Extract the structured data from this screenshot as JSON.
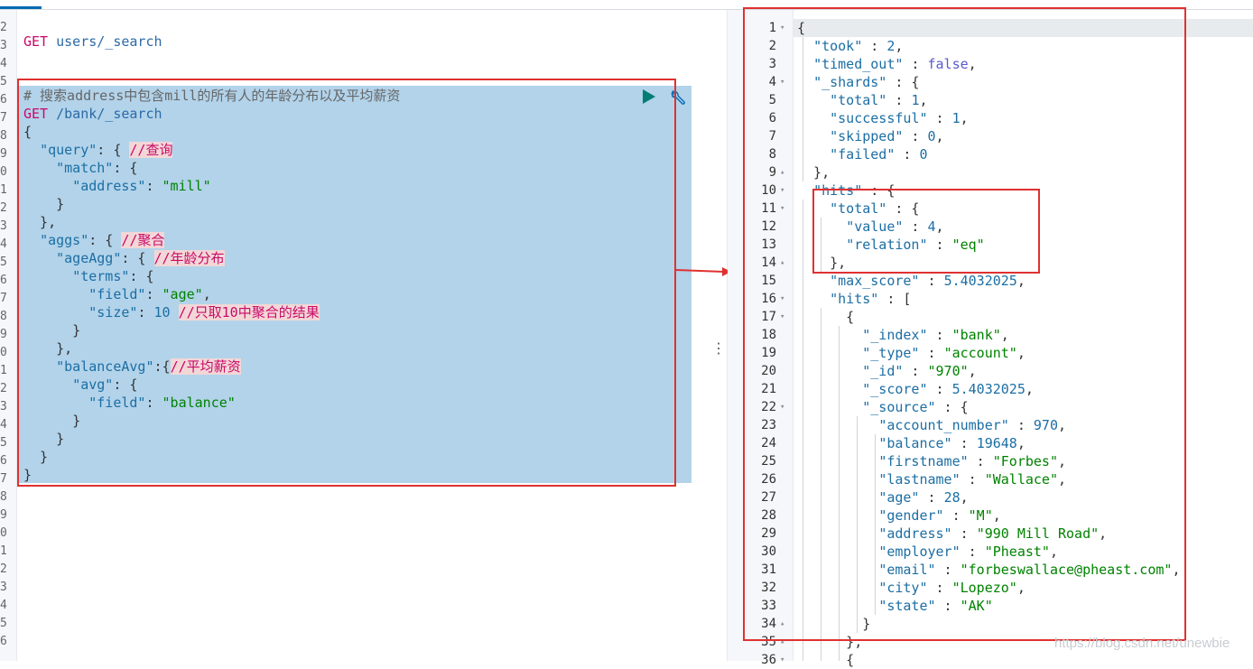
{
  "left_editor": {
    "lines": [
      {
        "segments": [
          {
            "t": "GET",
            "c": "method"
          },
          {
            "t": " users/_search",
            "c": "url"
          }
        ]
      },
      {
        "segments": []
      },
      {
        "segments": []
      },
      {
        "segments": [
          {
            "t": "# 搜索address中包含mill的所有人的年龄分布以及平均薪资",
            "c": "comment"
          }
        ]
      },
      {
        "segments": [
          {
            "t": "GET",
            "c": "method"
          },
          {
            "t": " /bank/_search",
            "c": "url"
          }
        ]
      },
      {
        "segments": [
          {
            "t": "{",
            "c": "punc"
          }
        ]
      },
      {
        "segments": [
          {
            "t": "  ",
            "c": "punc"
          },
          {
            "t": "\"query\"",
            "c": "key"
          },
          {
            "t": ": { ",
            "c": "punc"
          },
          {
            "t": "//查询",
            "c": "comment-hl"
          }
        ]
      },
      {
        "segments": [
          {
            "t": "    ",
            "c": "punc"
          },
          {
            "t": "\"match\"",
            "c": "key"
          },
          {
            "t": ": {",
            "c": "punc"
          }
        ]
      },
      {
        "segments": [
          {
            "t": "      ",
            "c": "punc"
          },
          {
            "t": "\"address\"",
            "c": "key"
          },
          {
            "t": ": ",
            "c": "punc"
          },
          {
            "t": "\"mill\"",
            "c": "str"
          }
        ]
      },
      {
        "segments": [
          {
            "t": "    }",
            "c": "punc"
          }
        ]
      },
      {
        "segments": [
          {
            "t": "  },",
            "c": "punc"
          }
        ]
      },
      {
        "segments": [
          {
            "t": "  ",
            "c": "punc"
          },
          {
            "t": "\"aggs\"",
            "c": "key"
          },
          {
            "t": ": { ",
            "c": "punc"
          },
          {
            "t": "//聚合",
            "c": "comment-hl"
          }
        ]
      },
      {
        "segments": [
          {
            "t": "    ",
            "c": "punc"
          },
          {
            "t": "\"ageAgg\"",
            "c": "key"
          },
          {
            "t": ": { ",
            "c": "punc"
          },
          {
            "t": "//年龄分布",
            "c": "comment-hl"
          }
        ]
      },
      {
        "segments": [
          {
            "t": "      ",
            "c": "punc"
          },
          {
            "t": "\"terms\"",
            "c": "key"
          },
          {
            "t": ": {",
            "c": "punc"
          }
        ]
      },
      {
        "segments": [
          {
            "t": "        ",
            "c": "punc"
          },
          {
            "t": "\"field\"",
            "c": "key"
          },
          {
            "t": ": ",
            "c": "punc"
          },
          {
            "t": "\"age\"",
            "c": "str"
          },
          {
            "t": ",",
            "c": "punc"
          }
        ]
      },
      {
        "segments": [
          {
            "t": "        ",
            "c": "punc"
          },
          {
            "t": "\"size\"",
            "c": "key"
          },
          {
            "t": ": ",
            "c": "punc"
          },
          {
            "t": "10",
            "c": "num"
          },
          {
            "t": " ",
            "c": "punc"
          },
          {
            "t": "//只取10中聚合的结果",
            "c": "comment-hl"
          }
        ]
      },
      {
        "segments": [
          {
            "t": "      }",
            "c": "punc"
          }
        ]
      },
      {
        "segments": [
          {
            "t": "    },",
            "c": "punc"
          }
        ]
      },
      {
        "segments": [
          {
            "t": "    ",
            "c": "punc"
          },
          {
            "t": "\"balanceAvg\"",
            "c": "key"
          },
          {
            "t": ":{",
            "c": "punc"
          },
          {
            "t": "//平均薪资",
            "c": "comment-hl"
          }
        ]
      },
      {
        "segments": [
          {
            "t": "      ",
            "c": "punc"
          },
          {
            "t": "\"avg\"",
            "c": "key"
          },
          {
            "t": ": {",
            "c": "punc"
          }
        ]
      },
      {
        "segments": [
          {
            "t": "        ",
            "c": "punc"
          },
          {
            "t": "\"field\"",
            "c": "key"
          },
          {
            "t": ": ",
            "c": "punc"
          },
          {
            "t": "\"balance\"",
            "c": "str"
          }
        ]
      },
      {
        "segments": [
          {
            "t": "      }",
            "c": "punc"
          }
        ]
      },
      {
        "segments": [
          {
            "t": "    }",
            "c": "punc"
          }
        ]
      },
      {
        "segments": [
          {
            "t": "  }",
            "c": "punc"
          }
        ]
      },
      {
        "segments": [
          {
            "t": "}",
            "c": "punc"
          }
        ]
      }
    ],
    "gutter_numbers": [
      "",
      "2",
      "3",
      "4",
      "5",
      "6",
      "7",
      "8",
      "9",
      "0",
      "1",
      "2",
      "3",
      "4",
      "5",
      "6",
      "7",
      "8",
      "9",
      "0",
      "1",
      "2",
      "3",
      "4",
      "5",
      "6",
      "7",
      "8",
      "9",
      "0",
      "1",
      "2",
      "3",
      "4",
      "5",
      "6"
    ]
  },
  "right_output": {
    "lines": [
      {
        "n": "1",
        "f": "▾",
        "segments": [
          {
            "t": "{",
            "c": "punc"
          }
        ]
      },
      {
        "n": "2",
        "f": "",
        "segments": [
          {
            "t": "  ",
            "c": "punc"
          },
          {
            "t": "\"took\"",
            "c": "key"
          },
          {
            "t": " : ",
            "c": "punc"
          },
          {
            "t": "2",
            "c": "num"
          },
          {
            "t": ",",
            "c": "punc"
          }
        ]
      },
      {
        "n": "3",
        "f": "",
        "segments": [
          {
            "t": "  ",
            "c": "punc"
          },
          {
            "t": "\"timed_out\"",
            "c": "key"
          },
          {
            "t": " : ",
            "c": "punc"
          },
          {
            "t": "false",
            "c": "bool"
          },
          {
            "t": ",",
            "c": "punc"
          }
        ]
      },
      {
        "n": "4",
        "f": "▾",
        "segments": [
          {
            "t": "  ",
            "c": "punc"
          },
          {
            "t": "\"_shards\"",
            "c": "key"
          },
          {
            "t": " : {",
            "c": "punc"
          }
        ]
      },
      {
        "n": "5",
        "f": "",
        "segments": [
          {
            "t": "    ",
            "c": "punc"
          },
          {
            "t": "\"total\"",
            "c": "key"
          },
          {
            "t": " : ",
            "c": "punc"
          },
          {
            "t": "1",
            "c": "num"
          },
          {
            "t": ",",
            "c": "punc"
          }
        ]
      },
      {
        "n": "6",
        "f": "",
        "segments": [
          {
            "t": "    ",
            "c": "punc"
          },
          {
            "t": "\"successful\"",
            "c": "key"
          },
          {
            "t": " : ",
            "c": "punc"
          },
          {
            "t": "1",
            "c": "num"
          },
          {
            "t": ",",
            "c": "punc"
          }
        ]
      },
      {
        "n": "7",
        "f": "",
        "segments": [
          {
            "t": "    ",
            "c": "punc"
          },
          {
            "t": "\"skipped\"",
            "c": "key"
          },
          {
            "t": " : ",
            "c": "punc"
          },
          {
            "t": "0",
            "c": "num"
          },
          {
            "t": ",",
            "c": "punc"
          }
        ]
      },
      {
        "n": "8",
        "f": "",
        "segments": [
          {
            "t": "    ",
            "c": "punc"
          },
          {
            "t": "\"failed\"",
            "c": "key"
          },
          {
            "t": " : ",
            "c": "punc"
          },
          {
            "t": "0",
            "c": "num"
          }
        ]
      },
      {
        "n": "9",
        "f": "▴",
        "segments": [
          {
            "t": "  },",
            "c": "punc"
          }
        ]
      },
      {
        "n": "10",
        "f": "▾",
        "segments": [
          {
            "t": "  ",
            "c": "punc"
          },
          {
            "t": "\"hits\"",
            "c": "key"
          },
          {
            "t": " : {",
            "c": "punc"
          }
        ]
      },
      {
        "n": "11",
        "f": "▾",
        "segments": [
          {
            "t": "    ",
            "c": "punc"
          },
          {
            "t": "\"total\"",
            "c": "key"
          },
          {
            "t": " : {",
            "c": "punc"
          }
        ]
      },
      {
        "n": "12",
        "f": "",
        "segments": [
          {
            "t": "      ",
            "c": "punc"
          },
          {
            "t": "\"value\"",
            "c": "key"
          },
          {
            "t": " : ",
            "c": "punc"
          },
          {
            "t": "4",
            "c": "num"
          },
          {
            "t": ",",
            "c": "punc"
          }
        ]
      },
      {
        "n": "13",
        "f": "",
        "segments": [
          {
            "t": "      ",
            "c": "punc"
          },
          {
            "t": "\"relation\"",
            "c": "key"
          },
          {
            "t": " : ",
            "c": "punc"
          },
          {
            "t": "\"eq\"",
            "c": "str"
          }
        ]
      },
      {
        "n": "14",
        "f": "▴",
        "segments": [
          {
            "t": "    },",
            "c": "punc"
          }
        ]
      },
      {
        "n": "15",
        "f": "",
        "segments": [
          {
            "t": "    ",
            "c": "punc"
          },
          {
            "t": "\"max_score\"",
            "c": "key"
          },
          {
            "t": " : ",
            "c": "punc"
          },
          {
            "t": "5.4032025",
            "c": "num"
          },
          {
            "t": ",",
            "c": "punc"
          }
        ]
      },
      {
        "n": "16",
        "f": "▾",
        "segments": [
          {
            "t": "    ",
            "c": "punc"
          },
          {
            "t": "\"hits\"",
            "c": "key"
          },
          {
            "t": " : [",
            "c": "punc"
          }
        ]
      },
      {
        "n": "17",
        "f": "▾",
        "segments": [
          {
            "t": "      {",
            "c": "punc"
          }
        ]
      },
      {
        "n": "18",
        "f": "",
        "segments": [
          {
            "t": "        ",
            "c": "punc"
          },
          {
            "t": "\"_index\"",
            "c": "key"
          },
          {
            "t": " : ",
            "c": "punc"
          },
          {
            "t": "\"bank\"",
            "c": "str"
          },
          {
            "t": ",",
            "c": "punc"
          }
        ]
      },
      {
        "n": "19",
        "f": "",
        "segments": [
          {
            "t": "        ",
            "c": "punc"
          },
          {
            "t": "\"_type\"",
            "c": "key"
          },
          {
            "t": " : ",
            "c": "punc"
          },
          {
            "t": "\"account\"",
            "c": "str"
          },
          {
            "t": ",",
            "c": "punc"
          }
        ]
      },
      {
        "n": "20",
        "f": "",
        "segments": [
          {
            "t": "        ",
            "c": "punc"
          },
          {
            "t": "\"_id\"",
            "c": "key"
          },
          {
            "t": " : ",
            "c": "punc"
          },
          {
            "t": "\"970\"",
            "c": "str"
          },
          {
            "t": ",",
            "c": "punc"
          }
        ]
      },
      {
        "n": "21",
        "f": "",
        "segments": [
          {
            "t": "        ",
            "c": "punc"
          },
          {
            "t": "\"_score\"",
            "c": "key"
          },
          {
            "t": " : ",
            "c": "punc"
          },
          {
            "t": "5.4032025",
            "c": "num"
          },
          {
            "t": ",",
            "c": "punc"
          }
        ]
      },
      {
        "n": "22",
        "f": "▾",
        "segments": [
          {
            "t": "        ",
            "c": "punc"
          },
          {
            "t": "\"_source\"",
            "c": "key"
          },
          {
            "t": " : {",
            "c": "punc"
          }
        ]
      },
      {
        "n": "23",
        "f": "",
        "segments": [
          {
            "t": "          ",
            "c": "punc"
          },
          {
            "t": "\"account_number\"",
            "c": "key"
          },
          {
            "t": " : ",
            "c": "punc"
          },
          {
            "t": "970",
            "c": "num"
          },
          {
            "t": ",",
            "c": "punc"
          }
        ]
      },
      {
        "n": "24",
        "f": "",
        "segments": [
          {
            "t": "          ",
            "c": "punc"
          },
          {
            "t": "\"balance\"",
            "c": "key"
          },
          {
            "t": " : ",
            "c": "punc"
          },
          {
            "t": "19648",
            "c": "num"
          },
          {
            "t": ",",
            "c": "punc"
          }
        ]
      },
      {
        "n": "25",
        "f": "",
        "segments": [
          {
            "t": "          ",
            "c": "punc"
          },
          {
            "t": "\"firstname\"",
            "c": "key"
          },
          {
            "t": " : ",
            "c": "punc"
          },
          {
            "t": "\"Forbes\"",
            "c": "str"
          },
          {
            "t": ",",
            "c": "punc"
          }
        ]
      },
      {
        "n": "26",
        "f": "",
        "segments": [
          {
            "t": "          ",
            "c": "punc"
          },
          {
            "t": "\"lastname\"",
            "c": "key"
          },
          {
            "t": " : ",
            "c": "punc"
          },
          {
            "t": "\"Wallace\"",
            "c": "str"
          },
          {
            "t": ",",
            "c": "punc"
          }
        ]
      },
      {
        "n": "27",
        "f": "",
        "segments": [
          {
            "t": "          ",
            "c": "punc"
          },
          {
            "t": "\"age\"",
            "c": "key"
          },
          {
            "t": " : ",
            "c": "punc"
          },
          {
            "t": "28",
            "c": "num"
          },
          {
            "t": ",",
            "c": "punc"
          }
        ]
      },
      {
        "n": "28",
        "f": "",
        "segments": [
          {
            "t": "          ",
            "c": "punc"
          },
          {
            "t": "\"gender\"",
            "c": "key"
          },
          {
            "t": " : ",
            "c": "punc"
          },
          {
            "t": "\"M\"",
            "c": "str"
          },
          {
            "t": ",",
            "c": "punc"
          }
        ]
      },
      {
        "n": "29",
        "f": "",
        "segments": [
          {
            "t": "          ",
            "c": "punc"
          },
          {
            "t": "\"address\"",
            "c": "key"
          },
          {
            "t": " : ",
            "c": "punc"
          },
          {
            "t": "\"990 Mill Road\"",
            "c": "str"
          },
          {
            "t": ",",
            "c": "punc"
          }
        ]
      },
      {
        "n": "30",
        "f": "",
        "segments": [
          {
            "t": "          ",
            "c": "punc"
          },
          {
            "t": "\"employer\"",
            "c": "key"
          },
          {
            "t": " : ",
            "c": "punc"
          },
          {
            "t": "\"Pheast\"",
            "c": "str"
          },
          {
            "t": ",",
            "c": "punc"
          }
        ]
      },
      {
        "n": "31",
        "f": "",
        "segments": [
          {
            "t": "          ",
            "c": "punc"
          },
          {
            "t": "\"email\"",
            "c": "key"
          },
          {
            "t": " : ",
            "c": "punc"
          },
          {
            "t": "\"forbeswallace@pheast.com\"",
            "c": "str"
          },
          {
            "t": ",",
            "c": "punc"
          }
        ]
      },
      {
        "n": "32",
        "f": "",
        "segments": [
          {
            "t": "          ",
            "c": "punc"
          },
          {
            "t": "\"city\"",
            "c": "key"
          },
          {
            "t": " : ",
            "c": "punc"
          },
          {
            "t": "\"Lopezo\"",
            "c": "str"
          },
          {
            "t": ",",
            "c": "punc"
          }
        ]
      },
      {
        "n": "33",
        "f": "",
        "segments": [
          {
            "t": "          ",
            "c": "punc"
          },
          {
            "t": "\"state\"",
            "c": "key"
          },
          {
            "t": " : ",
            "c": "punc"
          },
          {
            "t": "\"AK\"",
            "c": "str"
          }
        ]
      },
      {
        "n": "34",
        "f": "▴",
        "segments": [
          {
            "t": "        }",
            "c": "punc"
          }
        ]
      },
      {
        "n": "35",
        "f": "▴",
        "segments": [
          {
            "t": "      },",
            "c": "punc"
          }
        ]
      },
      {
        "n": "36",
        "f": "▾",
        "segments": [
          {
            "t": "      {",
            "c": "punc"
          }
        ]
      }
    ]
  },
  "toolbar": {
    "run_icon": "play-icon",
    "wrench_icon": "wrench-icon"
  },
  "splitter_glyph": "⋮",
  "watermark": "https://blog.csdn.net/unewbie",
  "colors": {
    "selection": "#b2d3ea",
    "annotation_red": "#e03131",
    "run_green": "#017d73",
    "wrench_blue": "#006bb4"
  }
}
